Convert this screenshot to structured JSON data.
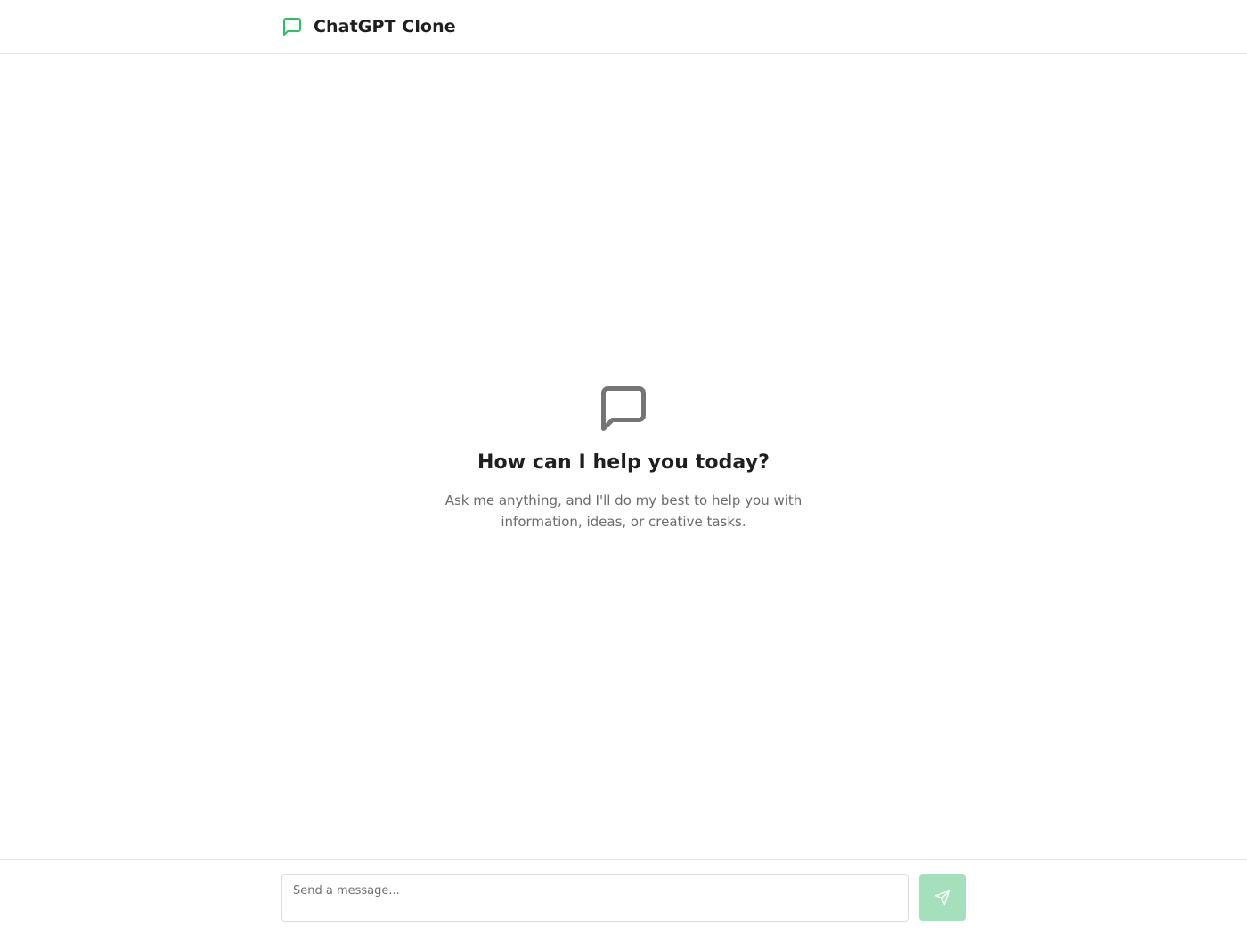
{
  "header": {
    "title": "ChatGPT Clone",
    "icon": "message-square-icon"
  },
  "empty_state": {
    "icon": "message-square-icon",
    "title": "How can I help you today?",
    "subtitle": "Ask me anything, and I'll do my best to help you with information, ideas, or creative tasks."
  },
  "composer": {
    "placeholder": "Send a message...",
    "value": "",
    "send_icon": "send-icon"
  },
  "colors": {
    "accent": "#22c55e",
    "send_button_bg": "#a3e0bb",
    "icon_gray": "#757575",
    "border": "#e6e6e6"
  }
}
